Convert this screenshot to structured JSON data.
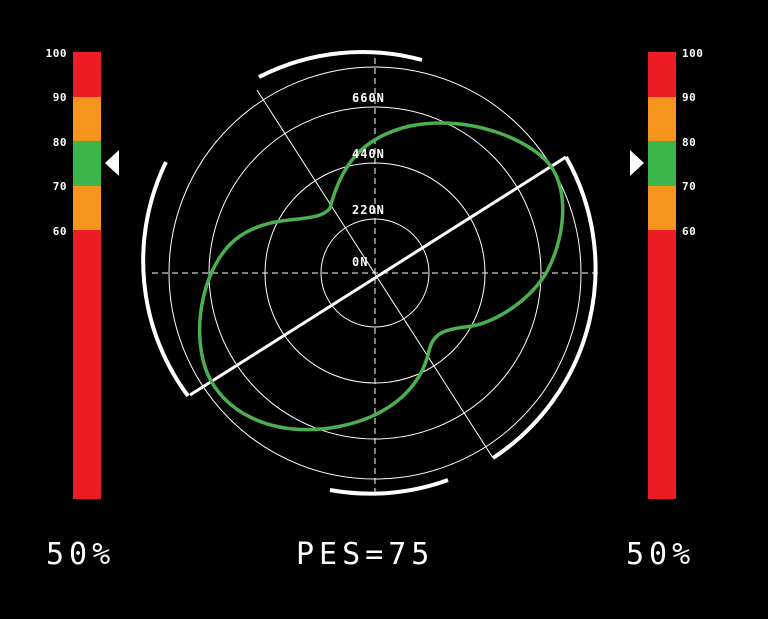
{
  "left_gauge": {
    "ticks": [
      "100",
      "90",
      "80",
      "70",
      "60"
    ],
    "indicator_value": 75,
    "readout": "50%"
  },
  "right_gauge": {
    "ticks": [
      "100",
      "90",
      "80",
      "70",
      "60"
    ],
    "indicator_value": 75,
    "readout": "50%"
  },
  "gauge_scale": {
    "min": 0,
    "max": 100
  },
  "gauge_bands": [
    {
      "from": 90,
      "to": 100,
      "color": "#ee1c25"
    },
    {
      "from": 80,
      "to": 90,
      "color": "#f7941d"
    },
    {
      "from": 70,
      "to": 80,
      "color": "#39b54a"
    },
    {
      "from": 60,
      "to": 70,
      "color": "#f7941d"
    },
    {
      "from": 0,
      "to": 60,
      "color": "#ee1c25"
    }
  ],
  "polar": {
    "ring_labels": [
      "660N",
      "440N",
      "220N",
      "0N"
    ],
    "curve_color": "#4caf50",
    "pes_label": "PES=75"
  }
}
